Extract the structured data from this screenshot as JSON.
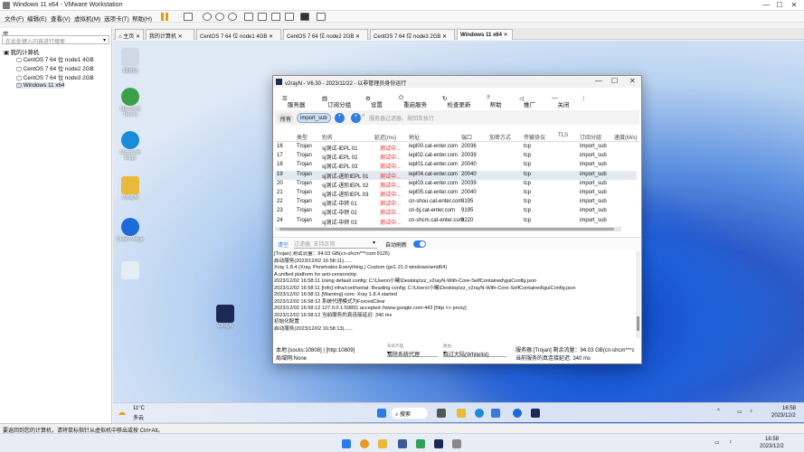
{
  "app": {
    "title": "Windows 11 x64 - VMware Workstation"
  },
  "menu": [
    "文件(F)",
    "编辑(E)",
    "查看(V)",
    "虚拟机(M)",
    "选项卡(T)",
    "帮助(H)"
  ],
  "library": {
    "title": "库",
    "search_placeholder": "在此处键入内容进行搜索",
    "root": "我的计算机",
    "vms": [
      "CentOS 7 64 位 node1 4GB",
      "CentOS 7 64 位 node2 2GB",
      "CentOS 7 64 位 node3 2GB",
      "Windows 11 x64"
    ]
  },
  "tabs": [
    "主页",
    "我的计算机",
    "CentOS 7 64 位 node1 4GB",
    "CentOS 7 64 位 node2 2GB",
    "CentOS 7 64 位 node3 2GB",
    "Windows 11 x64"
  ],
  "desktop_icons": [
    "回收站",
    "Microsoft Teams",
    "Microsoft Edge",
    "v2rayN",
    "Clash Verge",
    "v2rayN"
  ],
  "v2rayn": {
    "title": "v2rayN - V6.30 - 2023/11/22 - 以非管理员身份运行",
    "toolbar": [
      "服务器",
      "订阅分组",
      "设置",
      "重启服务",
      "检查更新",
      "帮助",
      "推广",
      "关闭"
    ],
    "filter": {
      "all": "所有",
      "group": "import_sub",
      "placeholder": "服务器过滤器，按回车执行"
    },
    "columns": [
      "类型",
      "别名",
      "延迟(ms)",
      "地址",
      "端口",
      "加密方式",
      "传输协议",
      "TLS",
      "订阅分组",
      "速度(M/s)"
    ],
    "rows": [
      [
        "16",
        "Trojan",
        "sj测试-IEPL 01",
        "测试中...",
        "iepl00.cat-enter.com",
        "20036",
        "",
        "tcp",
        "",
        "import_sub"
      ],
      [
        "17",
        "Trojan",
        "sj测试-IEPL 02",
        "测试中...",
        "iepl02.cat-enter.com",
        "20039",
        "",
        "tcp",
        "",
        "import_sub"
      ],
      [
        "18",
        "Trojan",
        "sj测试-IEPL 03",
        "测试中...",
        "iepl01.cat-enter.com",
        "20040",
        "",
        "tcp",
        "",
        "import_sub"
      ],
      [
        "19",
        "Trojan",
        "sj测试-进阶IEPL 01",
        "测试中...",
        "iepl04.cat-enter.com",
        "20040",
        "",
        "tcp",
        "",
        "import_sub"
      ],
      [
        "20",
        "Trojan",
        "sj测试-进阶IEPL 02",
        "测试中...",
        "iepl03.cat-enter.com",
        "20039",
        "",
        "tcp",
        "",
        "import_sub"
      ],
      [
        "21",
        "Trojan",
        "sj测试-进阶IEPL 03",
        "测试中...",
        "iepl05.cat-enter.com",
        "20040",
        "",
        "tcp",
        "",
        "import_sub"
      ],
      [
        "22",
        "Trojan",
        "sj测试-中转 01",
        "测试中...",
        "cn-shou.cat-enter.com",
        "9195",
        "",
        "tcp",
        "",
        "import_sub"
      ],
      [
        "23",
        "Trojan",
        "sj测试-中转 02",
        "测试中...",
        "cn-bj.cat-enter.com",
        "9195",
        "",
        "tcp",
        "",
        "import_sub"
      ],
      [
        "24",
        "Trojan",
        "sj测试-中转 03",
        "测试中...",
        "cn-shcm.cat-enter.com",
        "9220",
        "",
        "tcp",
        "",
        "import_sub"
      ]
    ],
    "log_bar": {
      "clear": "清空",
      "filter_placeholder": "过滤器, 支持正则",
      "auto_refresh": "自动刷新"
    },
    "log": [
      "[Trojan] 测试流量：94.03 GB(cn-shcm***com:9125)",
      "启动服务(2023/12/02 16:58:11)......",
      "Xray 1.8.4 (Xray, Penetrates Everything.) Custom (go1.21.0 windows/amd64)",
      "A unified platform for anti-censorship.",
      "2023/12/02 16:58:11 Using default config:  C:\\Users\\小曦\\Desktop\\zz_v2rayN-With-Core-SelfContained\\guiConfig.json",
      "2023/12/02 16:58:11 [Info] infra/conf/serial: Reading config: C:\\Users\\小曦\\Desktop\\zz_v2rayN-With-Core-SelfContained\\guiConfig.json",
      "2023/12/02 16:58:11 [Warning] core: Xray 1.8.4 started",
      "2023/12/02 16:58:12 系统代理模式为ForcedClear",
      "2023/12/02 16:58:12 127.0.0.1:59891 accepted //www.google.com:443 [http >> proxy]",
      "2023/12/02 16:58:12 当前服务的真连接延迟: 340 ms",
      "初始化配置",
      "启动服务(2023/12/02 16:58:13)......"
    ],
    "status": {
      "ports": "本地:[socks:10808] | [http:10809]",
      "mode": "局域网:None",
      "sysproxy_label": "系统代理",
      "sysproxy_value": "清除系统代理",
      "routing_label": "路由",
      "routing_value": "绕过大陆(Whitelist)",
      "server": "服务器:[Trojan] 剩余流量：94.03 GB(cn-shcm***c",
      "latency": "当前服务的真连接延迟: 340 ms"
    }
  },
  "guest_taskbar": {
    "weather_temp": "11°C",
    "weather_desc": "多云",
    "search": "搜索",
    "time": "16:58",
    "date": "2023/12/2"
  },
  "statusbar": "要返回到您的计算机，请将鼠标指针从虚拟机中移出或按 Ctrl+Alt。",
  "host_taskbar": {
    "time": "16:58",
    "date": "2023/12/2"
  }
}
